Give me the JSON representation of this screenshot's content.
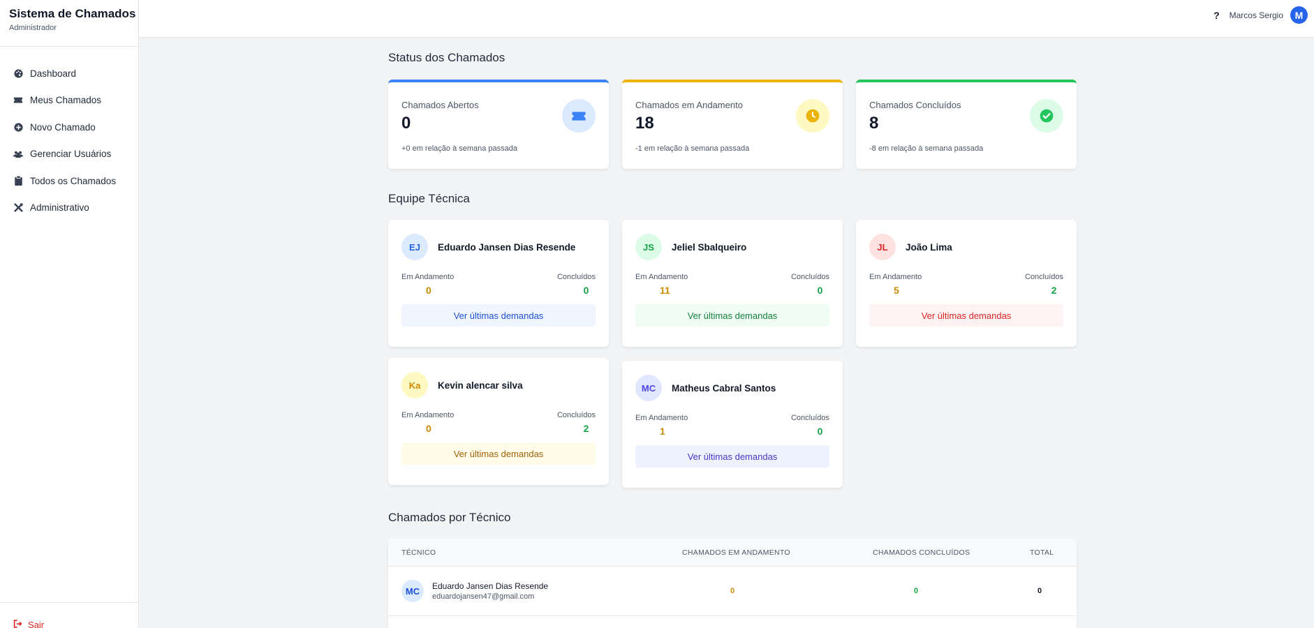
{
  "app": {
    "title": "Sistema de Chamados",
    "role": "Administrador"
  },
  "sidebar": {
    "items": [
      {
        "label": "Dashboard",
        "icon": "palette-icon"
      },
      {
        "label": "Meus Chamados",
        "icon": "ticket-icon"
      },
      {
        "label": "Novo Chamado",
        "icon": "plus-circle-icon"
      },
      {
        "label": "Gerenciar Usuários",
        "icon": "users-icon"
      },
      {
        "label": "Todos os Chamados",
        "icon": "clipboard-icon"
      },
      {
        "label": "Administrativo",
        "icon": "tools-icon"
      }
    ],
    "logout_label": "Sair"
  },
  "topbar": {
    "help": "?",
    "user_name": "Marcos Sergio",
    "avatar_initial": "M"
  },
  "status": {
    "title": "Status dos Chamados",
    "cards": [
      {
        "label": "Chamados Abertos",
        "value": "0",
        "trend": "+0 em relação à semana passada",
        "color": "#3b82f6",
        "icon": "ticket-icon"
      },
      {
        "label": "Chamados em Andamento",
        "value": "18",
        "trend": "-1 em relação à semana passada",
        "color": "#eab308",
        "icon": "clock-icon"
      },
      {
        "label": "Chamados Concluídos",
        "value": "8",
        "trend": "-8 em relação à semana passada",
        "color": "#22c55e",
        "icon": "check-circle-icon"
      }
    ]
  },
  "team": {
    "title": "Equipe Técnica",
    "stat_labels": {
      "in_progress": "Em Andamento",
      "done": "Concluídos"
    },
    "button_label": "Ver últimas demandas",
    "members": [
      {
        "initials": "EJ",
        "name": "Eduardo Jansen Dias Resende",
        "in_progress": "0",
        "done": "0",
        "theme": "blue"
      },
      {
        "initials": "JS",
        "name": "Jeliel Sbalqueiro",
        "in_progress": "11",
        "done": "0",
        "theme": "green"
      },
      {
        "initials": "JL",
        "name": "João Lima",
        "in_progress": "5",
        "done": "2",
        "theme": "red"
      },
      {
        "initials": "Ka",
        "name": "Kevin alencar silva",
        "in_progress": "0",
        "done": "2",
        "theme": "yellow"
      },
      {
        "initials": "MC",
        "name": "Matheus Cabral Santos",
        "in_progress": "1",
        "done": "0",
        "theme": "indigo"
      }
    ]
  },
  "by_tech": {
    "title": "Chamados por Técnico",
    "columns": [
      "TÉCNICO",
      "CHAMADOS EM ANDAMENTO",
      "CHAMADOS CONCLUÍDOS",
      "TOTAL"
    ],
    "rows": [
      {
        "initials": "MC",
        "name": "Eduardo Jansen Dias Resende",
        "email": "eduardojansen47@gmail.com",
        "in_progress": "0",
        "done": "0",
        "total": "0"
      }
    ]
  }
}
